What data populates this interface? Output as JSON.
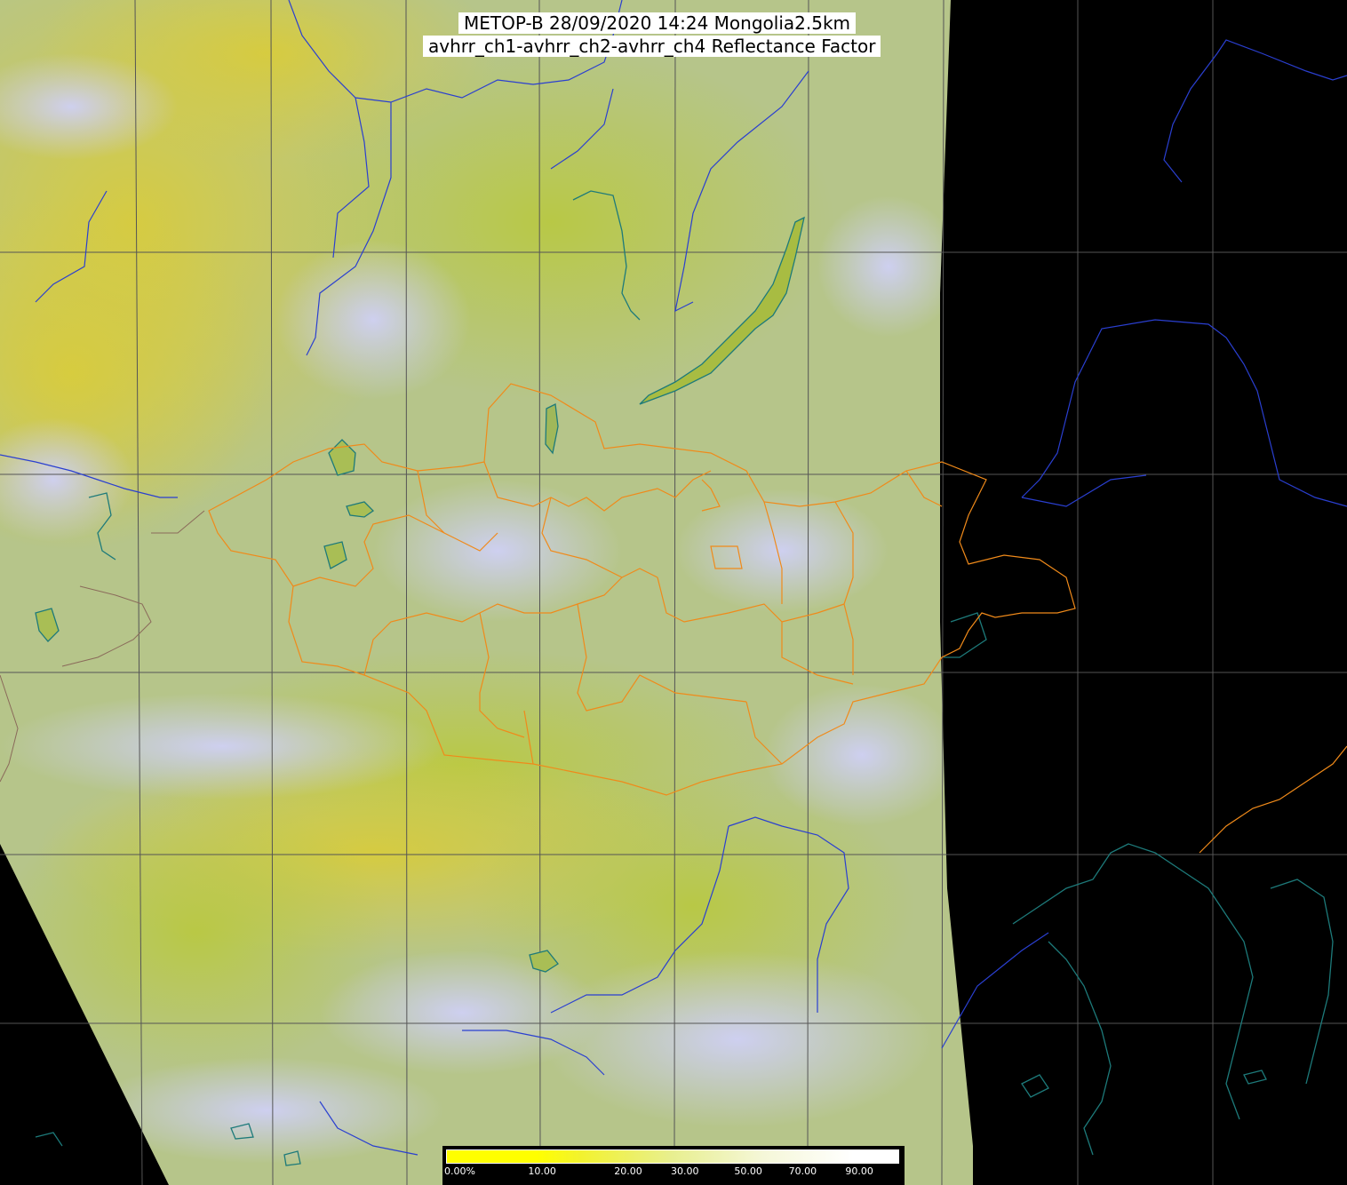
{
  "header": {
    "line1": "METOP-B 28/09/2020 14:24 Mongolia2.5km",
    "line2": "avhrr_ch1-avhrr_ch2-avhrr_ch4 Reflectance Factor"
  },
  "colors": {
    "background": "#000000",
    "swath_base": "#b9c98f",
    "cloud": "#c8c8f0",
    "desert": "#d6c53c",
    "grid": "#555555",
    "river": "#2a3fd0",
    "border": "#f08a1a",
    "coast": "#1d7a7a"
  },
  "legend": {
    "tick_labels": [
      "0.00%",
      "10.00",
      "20.00",
      "30.00",
      "50.00",
      "70.00",
      "90.00"
    ],
    "stops": [
      0,
      10,
      20,
      30,
      50,
      70,
      90,
      100
    ],
    "colors": [
      "#ffff00",
      "#ffff00",
      "#ffff00",
      "#f2f230",
      "#e8ef90",
      "#f5f7d8",
      "#ffffff",
      "#ffffff"
    ]
  }
}
